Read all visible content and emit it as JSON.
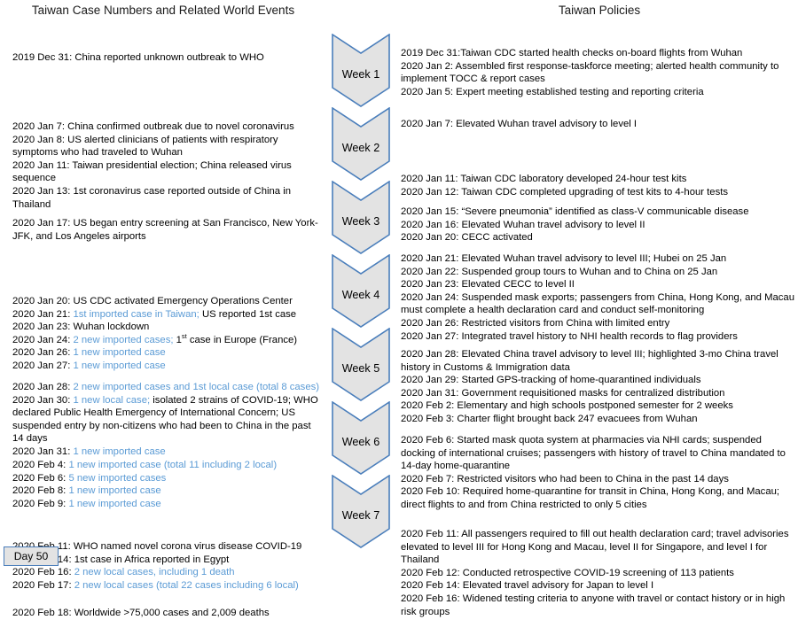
{
  "headers": {
    "left": "Taiwan Case Numbers and Related World Events",
    "right": "Taiwan Policies"
  },
  "colors": {
    "chevron_fill": "#e3e3e3",
    "chevron_stroke": "#4a7ebb",
    "highlight_text": "#5b9bd5",
    "body_text": "#000000"
  },
  "timeline": {
    "weeks": [
      {
        "label": "Week 1"
      },
      {
        "label": "Week 2"
      },
      {
        "label": "Week 3"
      },
      {
        "label": "Week 4"
      },
      {
        "label": "Week 5"
      },
      {
        "label": "Week 6"
      },
      {
        "label": "Week 7"
      }
    ],
    "end_marker": "Day 50"
  },
  "left_column": {
    "blocks": [
      {
        "week": 1,
        "lines": [
          {
            "segments": [
              {
                "text": "2019 Dec 31: China reported unknown outbreak to WHO",
                "style": "plain"
              }
            ]
          }
        ]
      },
      {
        "week": 2,
        "lines": [
          {
            "segments": [
              {
                "text": "2020 Jan 7: China confirmed outbreak due to novel coronavirus",
                "style": "plain"
              }
            ]
          },
          {
            "segments": [
              {
                "text": "2020 Jan 8: US alerted clinicians of patients with respiratory symptoms who had traveled to Wuhan",
                "style": "plain"
              }
            ]
          },
          {
            "segments": [
              {
                "text": "2020 Jan 11: Taiwan presidential election; China released virus sequence",
                "style": "plain"
              }
            ]
          },
          {
            "segments": [
              {
                "text": "2020 Jan 13: 1st coronavirus case reported outside of China in Thailand",
                "style": "plain"
              }
            ]
          }
        ]
      },
      {
        "week": 3,
        "lines": [
          {
            "segments": [
              {
                "text": "2020 Jan 17: US began entry screening at San Francisco, New York-JFK, and Los Angeles airports",
                "style": "plain"
              }
            ]
          }
        ]
      },
      {
        "week": 4,
        "lines": [
          {
            "segments": [
              {
                "text": "2020 Jan 20: US CDC activated Emergency Operations Center",
                "style": "plain"
              }
            ]
          },
          {
            "segments": [
              {
                "text": "2020 Jan 21: ",
                "style": "plain"
              },
              {
                "text": "1st imported case in Taiwan;",
                "style": "highlight"
              },
              {
                "text": " US reported 1st case",
                "style": "plain"
              }
            ]
          },
          {
            "segments": [
              {
                "text": "2020 Jan 23: Wuhan lockdown",
                "style": "plain"
              }
            ]
          },
          {
            "segments": [
              {
                "text": "2020 Jan 24: ",
                "style": "plain"
              },
              {
                "text": "2 new imported cases;",
                "style": "highlight"
              },
              {
                "text": " 1",
                "style": "plain"
              },
              {
                "text": "st",
                "style": "sup"
              },
              {
                "text": " case in Europe (France)",
                "style": "plain"
              }
            ]
          },
          {
            "segments": [
              {
                "text": "2020 Jan 26: ",
                "style": "plain"
              },
              {
                "text": "1 new imported case",
                "style": "highlight"
              }
            ]
          },
          {
            "segments": [
              {
                "text": "2020 Jan 27: ",
                "style": "plain"
              },
              {
                "text": "1 new imported case",
                "style": "highlight"
              }
            ]
          }
        ]
      },
      {
        "week": 5,
        "lines": [
          {
            "segments": [
              {
                "text": "2020 Jan 28: ",
                "style": "plain"
              },
              {
                "text": "2 new imported cases and 1st local case (total 8 cases)",
                "style": "highlight"
              }
            ]
          },
          {
            "segments": [
              {
                "text": "2020 Jan 30: ",
                "style": "plain"
              },
              {
                "text": "1 new local case;",
                "style": "highlight"
              },
              {
                "text": " isolated 2 strains of COVID-19; WHO declared Public Health Emergency of International Concern; US suspended entry by non-citizens who had been to China in the past 14 days",
                "style": "plain"
              }
            ]
          },
          {
            "segments": [
              {
                "text": "2020 Jan 31: ",
                "style": "plain"
              },
              {
                "text": "1 new imported case",
                "style": "highlight"
              }
            ]
          }
        ]
      },
      {
        "week": 6,
        "lines": [
          {
            "segments": [
              {
                "text": "2020 Feb 4: ",
                "style": "plain"
              },
              {
                "text": "1 new imported case (total 11 including 2 local)",
                "style": "highlight"
              }
            ]
          },
          {
            "segments": [
              {
                "text": "2020 Feb 6: ",
                "style": "plain"
              },
              {
                "text": "5 new imported cases",
                "style": "highlight"
              }
            ]
          },
          {
            "segments": [
              {
                "text": "2020 Feb 8: ",
                "style": "plain"
              },
              {
                "text": "1 new imported case",
                "style": "highlight"
              }
            ]
          },
          {
            "segments": [
              {
                "text": "2020 Feb 9: ",
                "style": "plain"
              },
              {
                "text": "1 new imported case",
                "style": "highlight"
              }
            ]
          }
        ]
      },
      {
        "week": 7,
        "lines": [
          {
            "segments": [
              {
                "text": "2020 Feb 11: WHO named novel corona virus disease COVID-19",
                "style": "plain"
              }
            ]
          },
          {
            "segments": [
              {
                "text": "2020 Feb 14: 1st case in Africa reported in Egypt",
                "style": "plain"
              }
            ]
          },
          {
            "segments": [
              {
                "text": "2020 Feb 16: ",
                "style": "plain"
              },
              {
                "text": "2 new local cases, including 1 death",
                "style": "highlight"
              }
            ]
          },
          {
            "segments": [
              {
                "text": "2020 Feb 17: ",
                "style": "plain"
              },
              {
                "text": "2 new local cases (total 22 cases including 6 local)",
                "style": "highlight"
              }
            ]
          }
        ]
      },
      {
        "week": 8,
        "lines": [
          {
            "segments": [
              {
                "text": "2020 Feb 18: Worldwide >75,000 cases and 2,009 deaths",
                "style": "plain"
              }
            ]
          }
        ]
      }
    ]
  },
  "right_column": {
    "blocks": [
      {
        "week": 1,
        "lines": [
          {
            "segments": [
              {
                "text": "2019 Dec 31:Taiwan CDC started health checks on-board flights from Wuhan",
                "style": "plain"
              }
            ]
          },
          {
            "segments": [
              {
                "text": "2020 Jan 2: Assembled first response-taskforce meeting; alerted health community to implement TOCC & report cases",
                "style": "plain"
              }
            ]
          },
          {
            "segments": [
              {
                "text": "2020 Jan 5: Expert meeting established testing and reporting criteria",
                "style": "plain"
              }
            ]
          }
        ]
      },
      {
        "week": 2,
        "lines": [
          {
            "segments": [
              {
                "text": "2020 Jan 7: Elevated Wuhan travel advisory to level I",
                "style": "plain"
              }
            ]
          }
        ]
      },
      {
        "week": "2b",
        "lines": [
          {
            "segments": [
              {
                "text": "2020 Jan 11: Taiwan CDC laboratory developed 24-hour test kits",
                "style": "plain"
              }
            ]
          },
          {
            "segments": [
              {
                "text": "2020 Jan 12: Taiwan CDC completed upgrading of test kits to 4-hour tests",
                "style": "plain"
              }
            ]
          }
        ]
      },
      {
        "week": 3,
        "lines": [
          {
            "segments": [
              {
                "text": "2020 Jan 15: “Severe pneumonia” identified as class-V communicable disease",
                "style": "plain"
              }
            ]
          },
          {
            "segments": [
              {
                "text": "2020 Jan 16: Elevated Wuhan travel advisory to level II",
                "style": "plain"
              }
            ]
          },
          {
            "segments": [
              {
                "text": "2020 Jan 20: CECC activated",
                "style": "plain"
              }
            ]
          }
        ]
      },
      {
        "week": 4,
        "lines": [
          {
            "segments": [
              {
                "text": "2020 Jan 21: Elevated Wuhan travel advisory to level III; Hubei on 25 Jan",
                "style": "plain"
              }
            ]
          },
          {
            "segments": [
              {
                "text": "2020 Jan 22: Suspended group tours to Wuhan and to China on 25 Jan",
                "style": "plain"
              }
            ]
          },
          {
            "segments": [
              {
                "text": "2020 Jan 23: Elevated CECC to level II",
                "style": "plain"
              }
            ]
          },
          {
            "segments": [
              {
                "text": "2020 Jan 24: Suspended mask exports; passengers from China, Hong Kong, and Macau must complete a health declaration card and conduct self-monitoring",
                "style": "plain"
              }
            ]
          },
          {
            "segments": [
              {
                "text": "2020 Jan 26: Restricted visitors from China with limited entry",
                "style": "plain"
              }
            ]
          },
          {
            "segments": [
              {
                "text": "2020 Jan 27: Integrated travel history to NHI health records to flag providers",
                "style": "plain"
              }
            ]
          }
        ]
      },
      {
        "week": 5,
        "lines": [
          {
            "segments": [
              {
                "text": "2020 Jan 28: Elevated China travel advisory to level III; highlighted 3-mo China travel history in Customs & Immigration data",
                "style": "plain"
              }
            ]
          },
          {
            "segments": [
              {
                "text": "2020 Jan 29: Started GPS-tracking of home-quarantined individuals",
                "style": "plain"
              }
            ]
          },
          {
            "segments": [
              {
                "text": "2020 Jan 31: Government requisitioned masks for centralized distribution",
                "style": "plain"
              }
            ]
          },
          {
            "segments": [
              {
                "text": "2020 Feb 2: Elementary and high schools postponed semester for 2 weeks",
                "style": "plain"
              }
            ]
          },
          {
            "segments": [
              {
                "text": "2020 Feb 3: Charter flight brought back 247 evacuees from Wuhan",
                "style": "plain"
              }
            ]
          }
        ]
      },
      {
        "week": 6,
        "lines": [
          {
            "segments": [
              {
                "text": "2020 Feb 6: Started mask quota system at pharmacies via NHI cards; suspended docking of international cruises; passengers with history of travel to China mandated to 14-day home-quarantine",
                "style": "plain"
              }
            ]
          },
          {
            "segments": [
              {
                "text": "2020 Feb 7: Restricted visitors who had been to China in the past 14 days",
                "style": "plain"
              }
            ]
          },
          {
            "segments": [
              {
                "text": "2020 Feb 10: Required home-quarantine for transit in China, Hong Kong, and Macau; direct flights to and from China restricted to only 5 cities",
                "style": "plain"
              }
            ]
          }
        ]
      },
      {
        "week": 7,
        "lines": [
          {
            "segments": [
              {
                "text": "2020 Feb 11: All passengers required to fill out health declaration card; travel advisories elevated to level III for Hong Kong and Macau, level II for Singapore, and level I for Thailand",
                "style": "plain"
              }
            ]
          },
          {
            "segments": [
              {
                "text": "2020 Feb 12: Conducted retrospective COVID-19 screening of 113 patients",
                "style": "plain"
              }
            ]
          },
          {
            "segments": [
              {
                "text": "2020 Feb 14: Elevated travel advisory for Japan to level I",
                "style": "plain"
              }
            ]
          },
          {
            "segments": [
              {
                "text": "2020 Feb 16: Widened testing criteria to anyone with travel or contact history or in high risk groups",
                "style": "plain"
              }
            ]
          }
        ]
      }
    ]
  }
}
